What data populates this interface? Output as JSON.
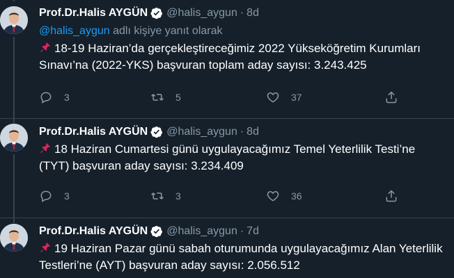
{
  "tweets": [
    {
      "author_name": "Prof.Dr.Halis AYGÜN",
      "handle": "@halis_aygun",
      "separator": "·",
      "time": "8d",
      "reply_to": {
        "mention": "@halis_aygun",
        "suffix": " adlı kişiye yanıt olarak"
      },
      "text": "18-19 Haziran’da gerçekleştireceğimiz 2022 Yükseköğretim Kurumları Sınavı’na (2022-YKS) başvuran toplam aday sayısı: 3.243.425",
      "replies": "3",
      "retweets": "5",
      "likes": "37"
    },
    {
      "author_name": "Prof.Dr.Halis AYGÜN",
      "handle": "@halis_aygun",
      "separator": "·",
      "time": "8d",
      "text": "18 Haziran Cumartesi günü uygulayacağımız Temel Yeterlilik Testi’ne (TYT) başvuran aday sayısı: 3.234.409",
      "replies": "3",
      "retweets": "3",
      "likes": "36"
    },
    {
      "author_name": "Prof.Dr.Halis AYGÜN",
      "handle": "@halis_aygun",
      "separator": "·",
      "time": "7d",
      "text": "19 Haziran Pazar günü sabah oturumunda uygulayacağımız Alan Yeterlilik Testleri’ne (AYT) başvuran aday sayısı: 2.056.512"
    }
  ],
  "icons": {
    "verified": "verified-badge-icon",
    "pin": "pushpin-icon",
    "reply": "reply-icon",
    "retweet": "retweet-icon",
    "like": "like-icon",
    "share": "share-icon"
  },
  "colors": {
    "background": "#15202b",
    "secondary_text": "#8899a6",
    "accent": "#1d9bf0",
    "divider": "#38444d"
  }
}
